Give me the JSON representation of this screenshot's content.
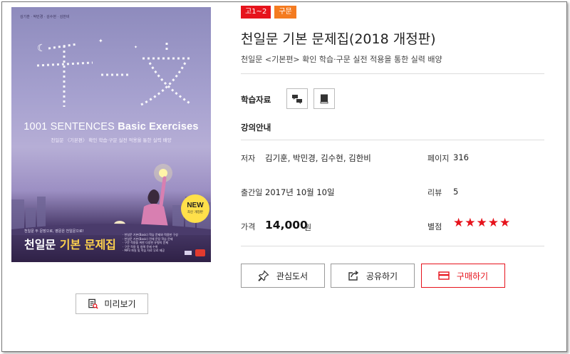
{
  "cover": {
    "authors": "김기훈 · 박민경 · 김수현 · 김한비",
    "title_en_light": "1001 SENTENCES ",
    "title_en_bold": "Basic Exercises",
    "subtitle": "천일문 〈기본편〉 확인 학습·구문 실전 적용을 통한 실력 배양",
    "badge_new": "NEW",
    "badge_sub": "최신 개정판",
    "tagline": "천일문 두 문장으로, 영문은 천일문으로!",
    "kr_title_a": "천일문 ",
    "kr_title_b": "기본 문제집",
    "bullets": [
      "· 천일문 기본(Basic) 학습 문제와 적용한 구성",
      "· 천일문 기본(Basic) 전체 문장 학습 문제",
      "· 구문 적용을 위한 다양한 유형의 문제",
      "· 구문 적용 및 청해 문제 수록",
      "· MP3 파일 및 학습 자료 무료 제공"
    ]
  },
  "preview_button": {
    "label": "미리보기",
    "icon": "preview-icon"
  },
  "tags": [
    {
      "label": "고1~2",
      "color": "#e6131c"
    },
    {
      "label": "구문",
      "color": "#f47b20"
    }
  ],
  "book": {
    "title": "천일문 기본 문제집(2018 개정판)",
    "description": "천일문 <기본편> 확인 학습·구문 실전 적용을 통한 실력 배양"
  },
  "materials": {
    "label": "학습자료",
    "icons": [
      "chat-bubbles-icon",
      "book-icon"
    ]
  },
  "lecture": {
    "label": "강의안내"
  },
  "info": {
    "author_label": "저자",
    "author_value": "김기훈, 박민경, 김수현, 김한비",
    "pages_label": "페이지",
    "pages_value": "316",
    "date_label": "출간일",
    "date_value": "2017년 10월 10일",
    "review_label": "리뷰",
    "review_value": "5",
    "price_label": "가격",
    "price_value": "14,000",
    "price_unit": "원",
    "rating_label": "별점",
    "rating_value": 5,
    "rating_max": 5,
    "rating_stars": "★★★★★"
  },
  "actions": {
    "wishlist": "관심도서",
    "share": "공유하기",
    "buy": "구매하기"
  },
  "colors": {
    "accent": "#e6131c",
    "orange": "#f47b20"
  }
}
